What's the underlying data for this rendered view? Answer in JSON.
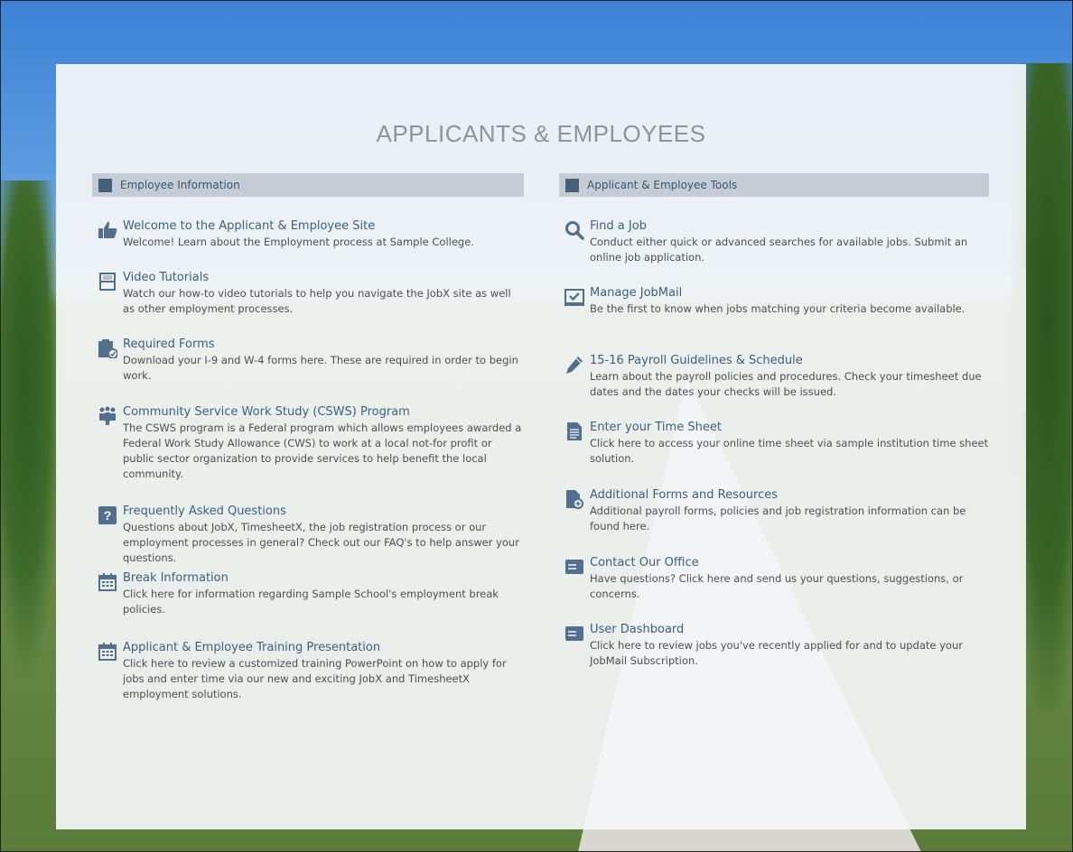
{
  "page": {
    "title": "APPLICANTS & EMPLOYEES"
  },
  "left": {
    "header": "Employee Information",
    "items": [
      {
        "icon": "thumbs-up-icon",
        "title": "Welcome to the Applicant & Employee Site",
        "desc": "Welcome! Learn about the Employment process at Sample College."
      },
      {
        "icon": "film-icon",
        "title": "Video Tutorials",
        "desc": "Watch our how-to video tutorials to help you navigate the JobX site as well as other employment processes."
      },
      {
        "icon": "clipboard-icon",
        "title": "Required Forms",
        "desc": "Download your I-9 and W-4 forms here.  These are required in order to begin work."
      },
      {
        "icon": "people-icon",
        "title": "Community Service Work Study (CSWS) Program",
        "desc": "The CSWS program is a Federal program which allows employees awarded a Federal Work Study Allowance (CWS) to work at a local not-for profit or public sector organization to provide services to help benefit the local community."
      },
      {
        "icon": "question-icon",
        "title": "Frequently Asked Questions",
        "desc": "Questions about JobX, TimesheetX, the job registration process or our employment processes in general? Check out our FAQ's to help answer your questions."
      },
      {
        "icon": "calendar-icon",
        "title": "Break Information",
        "desc": "Click here for information regarding Sample School's  employment break policies."
      },
      {
        "icon": "calendar-icon",
        "title": "Applicant & Employee Training Presentation",
        "desc": "Click here to review a customized training PowerPoint on how to apply for jobs and enter time via our new and exciting JobX and TimesheetX employment solutions."
      }
    ]
  },
  "right": {
    "header": "Applicant & Employee Tools",
    "items": [
      {
        "icon": "search-icon",
        "title": "Find a Job",
        "desc": "Conduct either quick or advanced searches for available jobs. Submit an online job application."
      },
      {
        "icon": "mail-check-icon",
        "title": "Manage JobMail",
        "desc": "Be the first to know when jobs matching your criteria become available."
      },
      {
        "icon": "pencil-icon",
        "title": "15-16 Payroll Guidelines & Schedule",
        "desc": "Learn about the payroll policies and procedures. Check your timesheet due dates and the dates your checks will be issued."
      },
      {
        "icon": "document-icon",
        "title": "Enter your Time Sheet",
        "desc": "Click here to access your online time sheet via sample institution time sheet solution."
      },
      {
        "icon": "document-add-icon",
        "title": "Additional Forms and Resources",
        "desc": "Additional payroll forms, policies and job registration information can be found here."
      },
      {
        "icon": "message-icon",
        "title": "Contact Our Office",
        "desc": "Have questions? Click here and send us your questions, suggestions, or concerns."
      },
      {
        "icon": "message-icon",
        "title": "User Dashboard",
        "desc": "Click here to review jobs you've recently applied for and to update your JobMail Subscription."
      }
    ]
  }
}
